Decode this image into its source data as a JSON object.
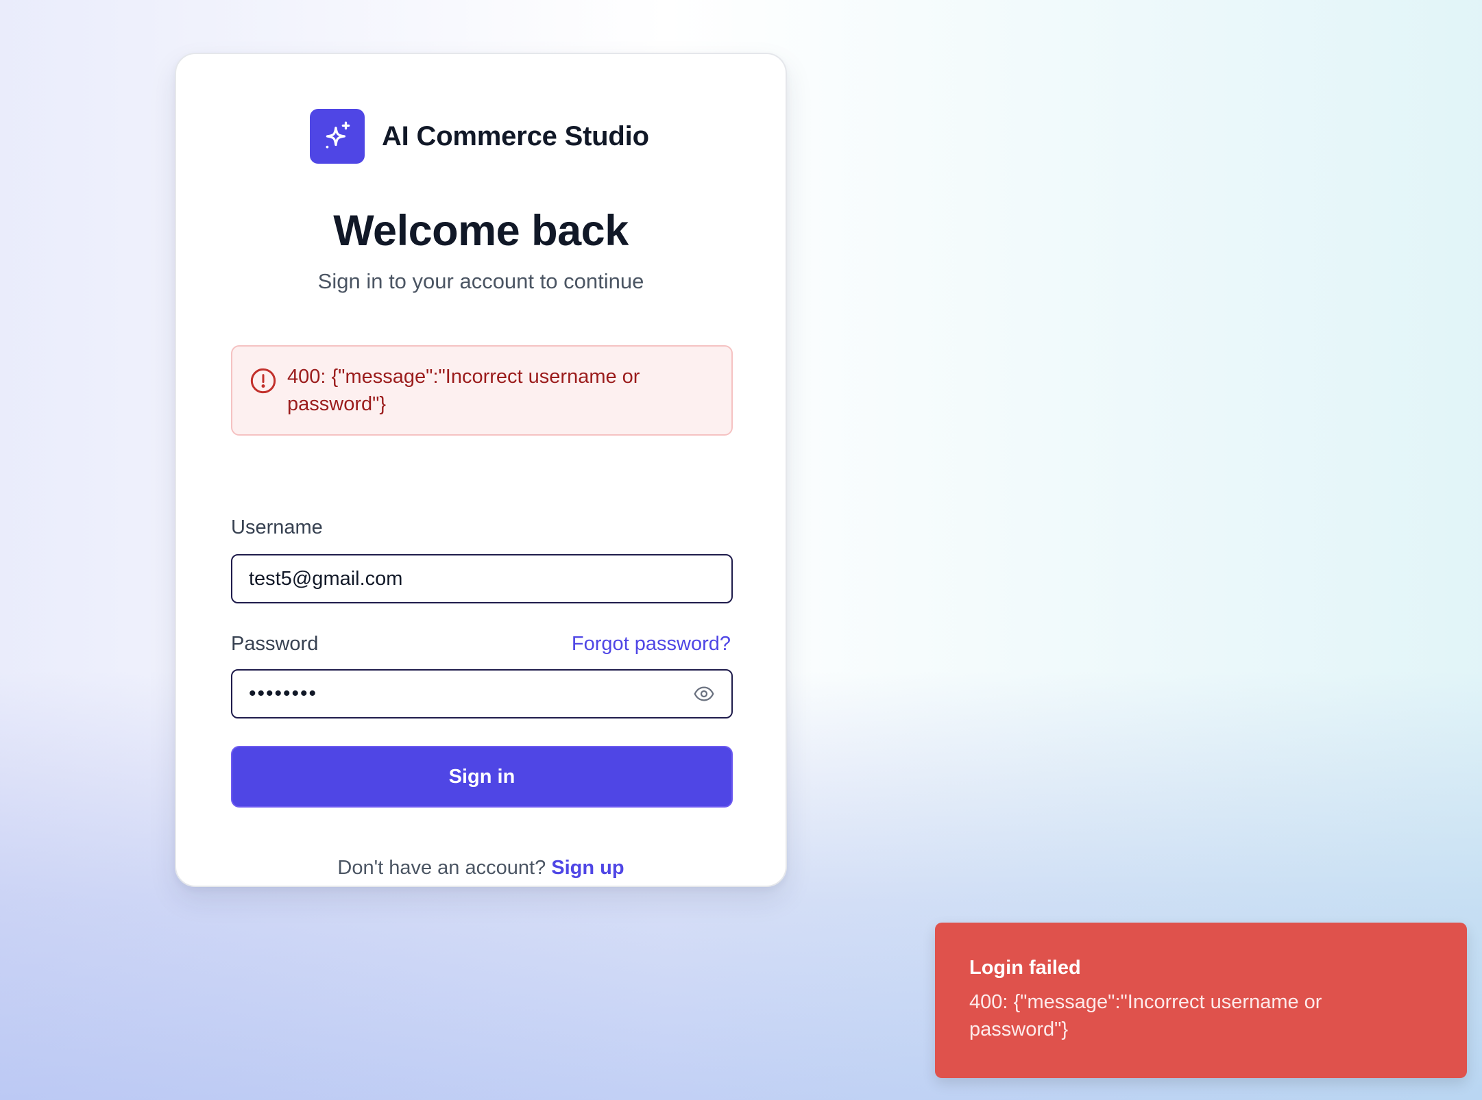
{
  "brand": {
    "name": "AI Commerce Studio",
    "logo_icon": "sparkle-icon",
    "accent_color": "#4f46e5"
  },
  "login": {
    "title": "Welcome back",
    "subtitle": "Sign in to your account to continue",
    "error_alert": {
      "icon": "alert-circle-icon",
      "message": "400: {\"message\":\"Incorrect username or password\"}"
    },
    "username": {
      "label": "Username",
      "value": "test5@gmail.com"
    },
    "password": {
      "label": "Password",
      "masked_value": "••••••••",
      "forgot_link": "Forgot password?",
      "toggle_icon": "eye-icon"
    },
    "submit_label": "Sign in",
    "signup_prompt": "Don't have an account?",
    "signup_link": "Sign up"
  },
  "toast": {
    "title": "Login failed",
    "message": "400: {\"message\":\"Incorrect username or password\"}",
    "color": "#df524c"
  }
}
